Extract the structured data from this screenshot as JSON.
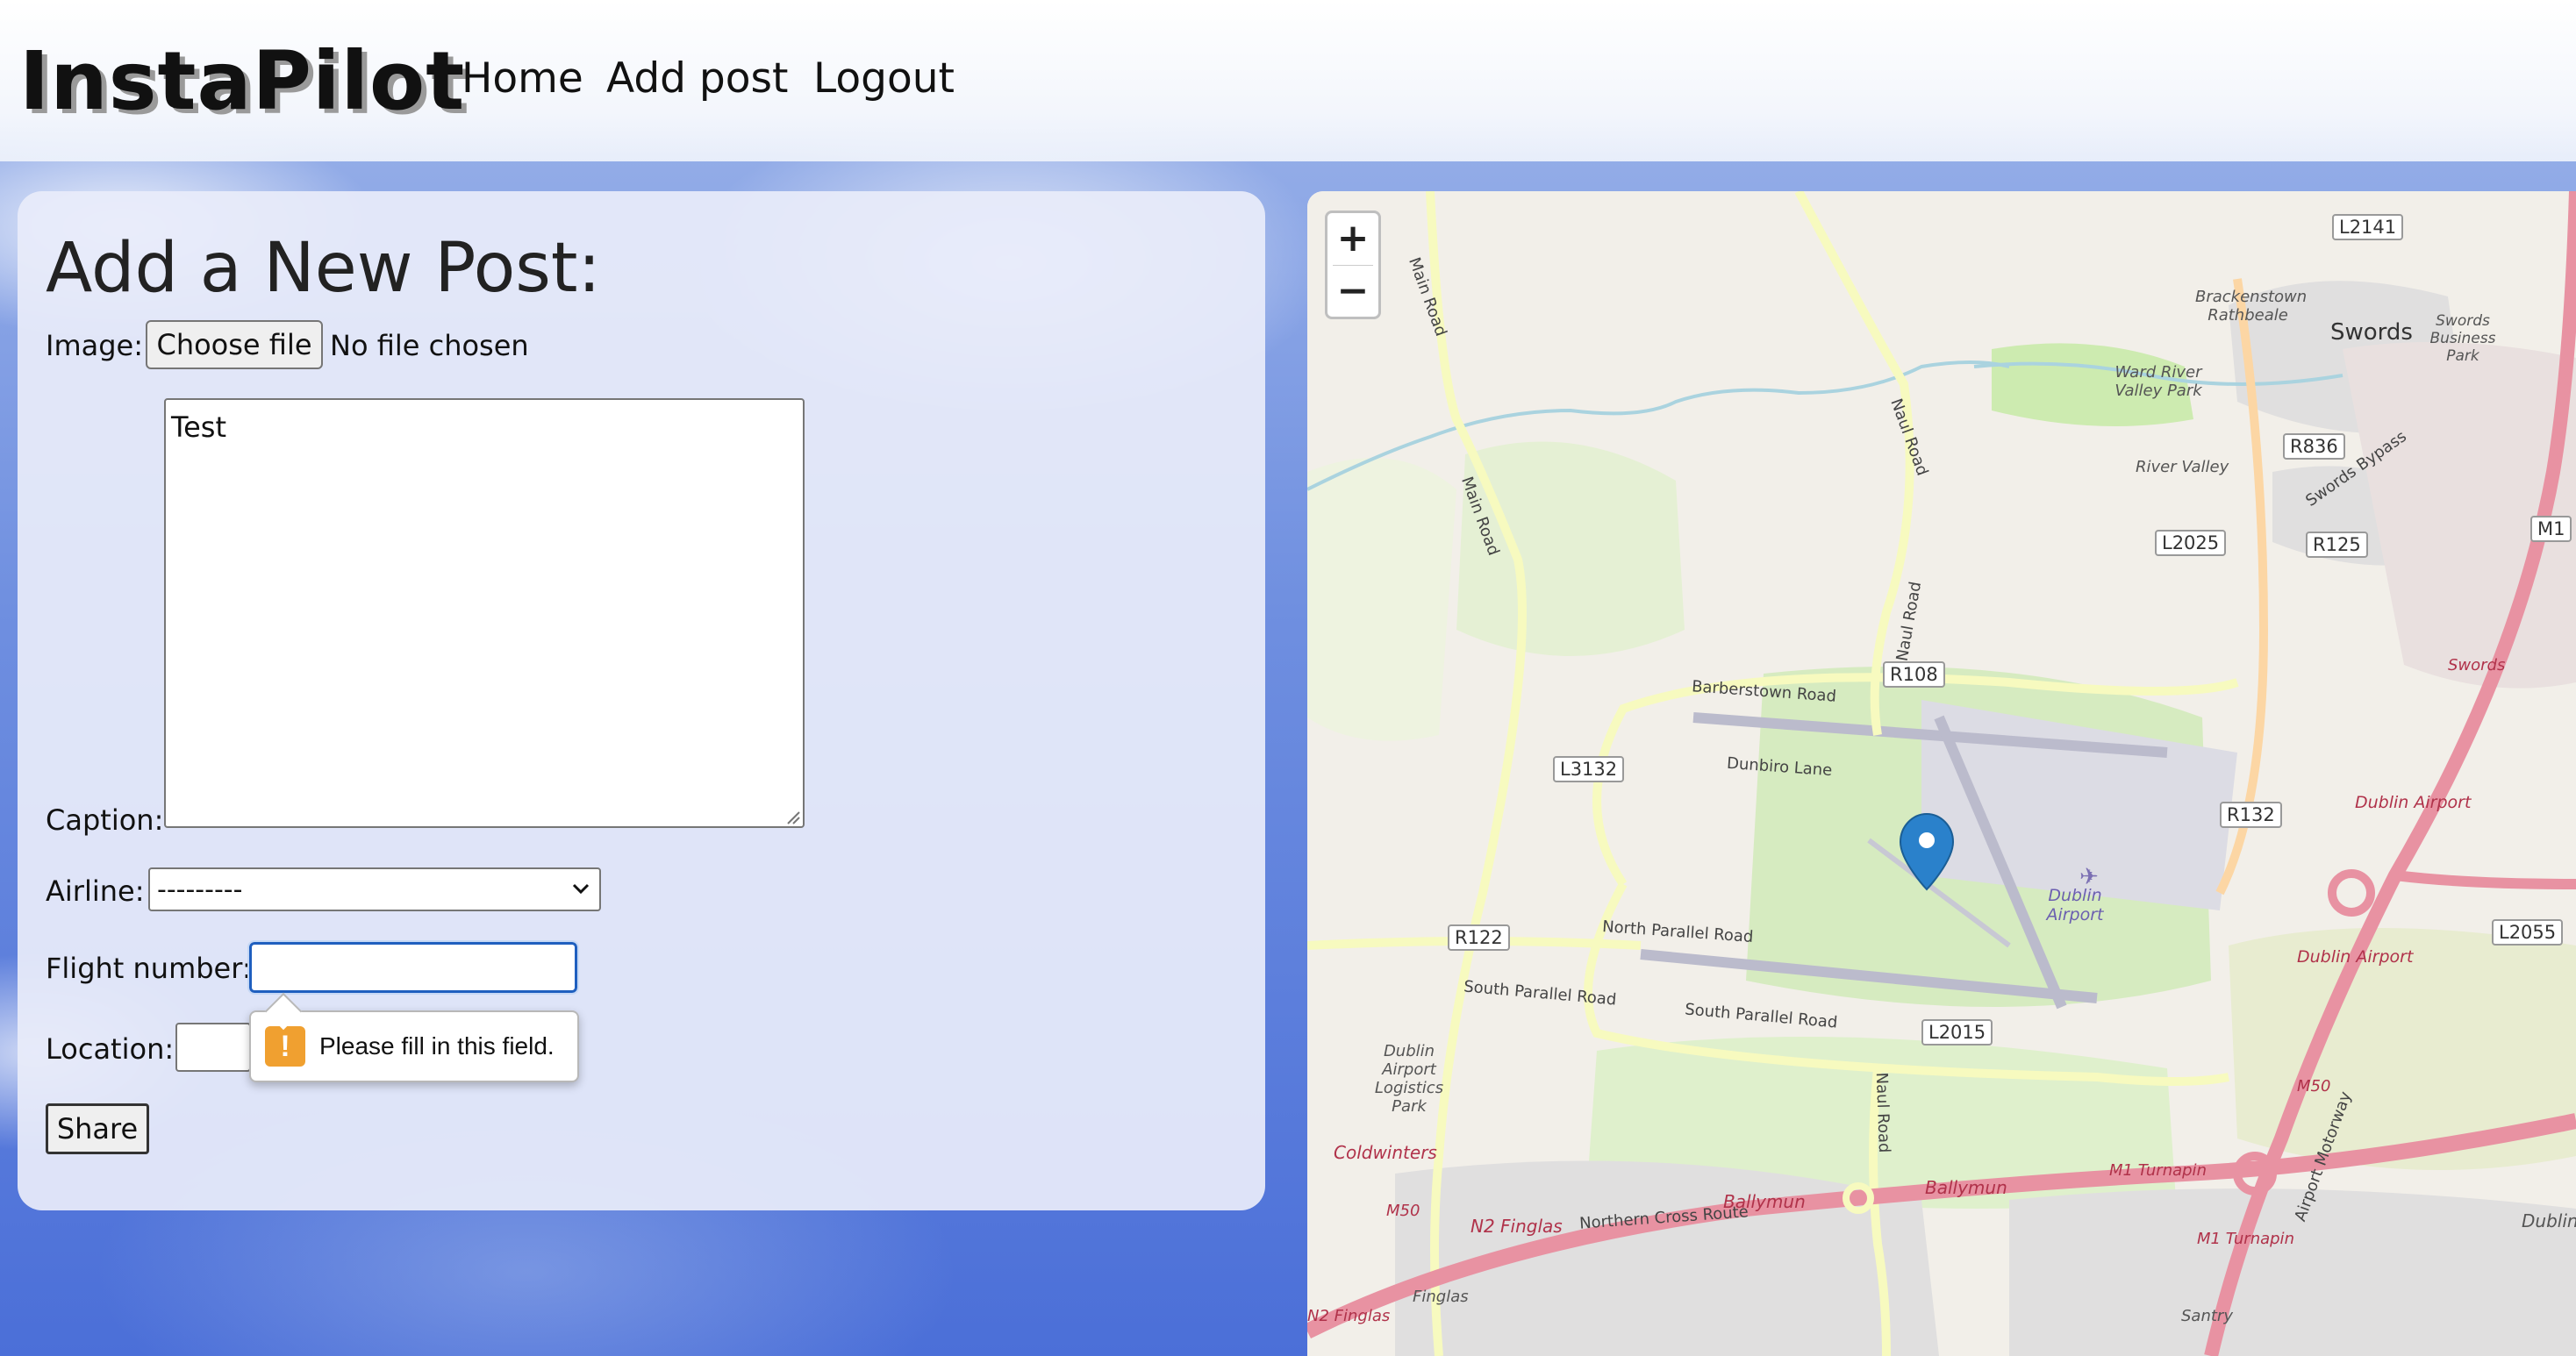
{
  "header": {
    "logo": "InstaPilot",
    "nav": [
      "Home",
      "Add post",
      "Logout"
    ]
  },
  "form": {
    "title": "Add a New Post:",
    "image_label": "Image:",
    "choose_file_label": "Choose file",
    "file_status": "No file chosen",
    "caption_label": "Caption:",
    "caption_value": "Test",
    "airline_label": "Airline:",
    "airline_selected": "---------",
    "flight_label": "Flight number:",
    "flight_value": "",
    "location_label": "Location:",
    "location_value": "",
    "validation_message": "Please fill in this field.",
    "share_label": "Share"
  },
  "map": {
    "zoom_in": "+",
    "zoom_out": "−",
    "road_badges": [
      "L2141",
      "R836",
      "M1",
      "R125",
      "L2025",
      "R108",
      "L3132",
      "R132",
      "R122",
      "L2015",
      "L2055"
    ],
    "road_names": [
      "Main Road",
      "Main Road",
      "Naul Road",
      "Naul Road",
      "Barberstown Road",
      "Dunbiro Lane",
      "North Parallel Road",
      "South Parallel Road",
      "South Parallel Road",
      "Naul Road",
      "Northern Cross Route",
      "Swords Bypass",
      "Airport Motorway"
    ],
    "places": [
      "Swords",
      "Brackenstown Rathbeale",
      "Ward River Valley Park",
      "River Valley",
      "Swords Business Park",
      "Dublin Airport",
      "Dublin Airport Logistics Park",
      "Coldwinters",
      "Ballymun",
      "Ballymun",
      "N2 Finglas",
      "Finglas",
      "Santry",
      "Dublin",
      "Swords",
      "Dublin Airport",
      "Dublin Airport",
      "M1 Turnapin",
      "M1 Turnapin",
      "M50",
      "M50",
      "N2 Finglas"
    ],
    "colors": {
      "motorway": "#e892a2",
      "primary": "#fcd6a4",
      "secondary": "#f7fabf",
      "runway": "#bbbbcc",
      "green": "#cdebb0",
      "residential": "#e0dfdf",
      "water": "#aad3df",
      "marker": "#2a81cb"
    }
  }
}
